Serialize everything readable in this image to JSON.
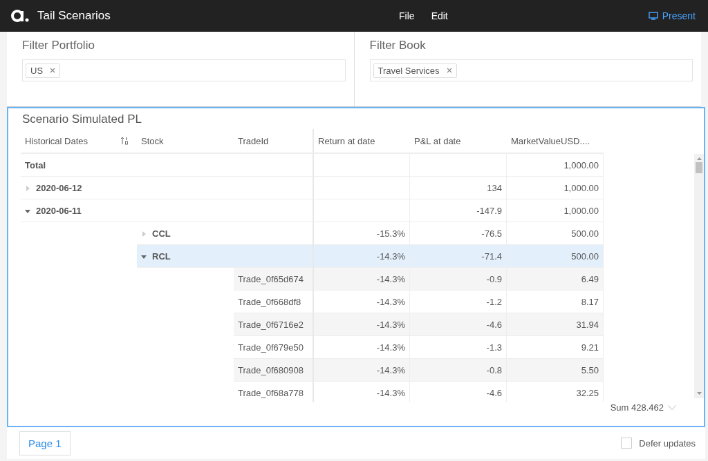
{
  "app": {
    "title": "Tail Scenarios",
    "menu": [
      {
        "label": "File"
      },
      {
        "label": "Edit"
      }
    ],
    "present": "Present"
  },
  "filters": [
    {
      "title": "Filter Portfolio",
      "tags": [
        "US"
      ]
    },
    {
      "title": "Filter Book",
      "tags": [
        "Travel Services"
      ]
    }
  ],
  "pivot": {
    "title": "Scenario Simulated PL",
    "columns": [
      {
        "label": "Historical Dates",
        "sorted": true
      },
      {
        "label": "Stock",
        "sorted": false
      },
      {
        "label": "TradeId",
        "sorted": false
      },
      {
        "label": "Return at date",
        "sorted": false
      },
      {
        "label": "P&L at date",
        "sorted": false
      },
      {
        "label": "MarketValueUSD....",
        "sorted": false
      }
    ],
    "total": {
      "label": "Total",
      "values": {
        "market_value": "1,000.00"
      }
    },
    "rows": [
      {
        "label": "2020-06-12",
        "expanded": false,
        "selected": false,
        "values": {
          "pnl": "134",
          "market_value": "1,000.00"
        }
      },
      {
        "label": "2020-06-11",
        "expanded": true,
        "selected": false,
        "values": {
          "pnl": "-147.9",
          "market_value": "1,000.00"
        },
        "children": [
          {
            "label": "CCL",
            "expanded": false,
            "selected": false,
            "values": {
              "return": "-15.3%",
              "pnl": "-76.5",
              "market_value": "500.00"
            }
          },
          {
            "label": "RCL",
            "expanded": true,
            "selected": true,
            "values": {
              "return": "-14.3%",
              "pnl": "-71.4",
              "market_value": "500.00"
            },
            "children": [
              {
                "label": "Trade_0f65d674",
                "selected": false,
                "values": {
                  "return": "-14.3%",
                  "pnl": "-0.9",
                  "market_value": "6.49"
                }
              },
              {
                "label": "Trade_0f668df8",
                "selected": false,
                "values": {
                  "return": "-14.3%",
                  "pnl": "-1.2",
                  "market_value": "8.17"
                }
              },
              {
                "label": "Trade_0f6716e2",
                "selected": false,
                "values": {
                  "return": "-14.3%",
                  "pnl": "-4.6",
                  "market_value": "31.94"
                }
              },
              {
                "label": "Trade_0f679e50",
                "selected": false,
                "values": {
                  "return": "-14.3%",
                  "pnl": "-1.3",
                  "market_value": "9.21"
                }
              },
              {
                "label": "Trade_0f680908",
                "selected": false,
                "values": {
                  "return": "-14.3%",
                  "pnl": "-0.8",
                  "market_value": "5.50"
                }
              },
              {
                "label": "Trade_0f68a778",
                "selected": false,
                "values": {
                  "return": "-14.3%",
                  "pnl": "-4.6",
                  "market_value": "32.25"
                }
              }
            ]
          }
        ]
      }
    ],
    "summary": "Sum 428.462"
  },
  "pages": [
    {
      "label": "Page 1",
      "selected": true
    }
  ],
  "defer_updates": {
    "label": "Defer updates",
    "checked": false
  }
}
